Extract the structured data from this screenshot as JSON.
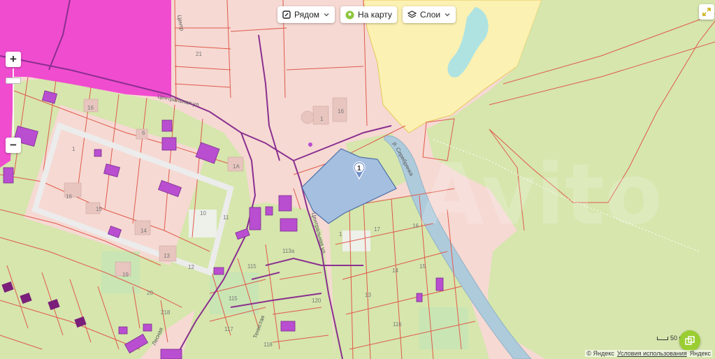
{
  "toolbar": {
    "nearby_label": "Рядом",
    "onmap_label": "На карту",
    "layers_label": "Слои"
  },
  "map": {
    "watermark": "Avito",
    "marker_label": "1",
    "streets": {
      "central1": "Центральная ул.",
      "central2": "Центральная ул.",
      "river": "р. Серебрянка",
      "lesnaya": "Лесная",
      "tenistaya": "Тенистая",
      "tsentr_top": "Центр"
    },
    "lots": {
      "l21": "21",
      "l16a": "16",
      "l1a": "1",
      "l16b": "16",
      "l6": "6",
      "l1": "1",
      "l16c": "16",
      "l15": "15",
      "l14": "14",
      "l13": "13",
      "l19": "19",
      "l20": "20",
      "l218": "218",
      "l10": "10",
      "l11": "11",
      "l12": "12",
      "l1a2": "1А",
      "l113": "113а",
      "l115": "115",
      "l115b": "115",
      "l117": "117",
      "l118": "118",
      "l120": "120",
      "l17": "17",
      "l16d": "16",
      "l14b": "14",
      "l15b": "15",
      "l13b": "13",
      "l116": "116",
      "l1s": "1"
    },
    "colors": {
      "background": "#f6d9d3",
      "green": "#d6e6ad",
      "yellow": "#fbf1b2",
      "magenta": "#f04ccf",
      "water": "#aecbdc",
      "parcel_line": "#e05a4b",
      "selected": "#a5bfe0",
      "building": "#b94ed0"
    }
  },
  "controls": {
    "zoom_in": "+",
    "zoom_out": "−",
    "scale_label": "50 м"
  },
  "attribution": {
    "copyright": "© Яндекс",
    "terms": "Условия использования",
    "brand": "Яндекс"
  }
}
